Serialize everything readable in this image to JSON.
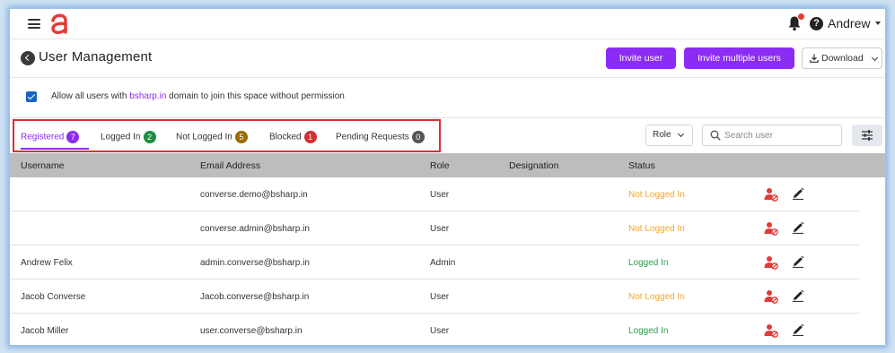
{
  "header": {
    "user_name": "Andrew",
    "notification_dot_color": "#e53935"
  },
  "page": {
    "title": "User Management",
    "invite_label": "Invite user",
    "invite_multiple_label": "Invite multiple users",
    "download_label": "Download"
  },
  "permission": {
    "checked": true,
    "text_before": "Allow all users with ",
    "domain": "bsharp.in",
    "text_after": " domain to join this space without permission"
  },
  "tabs": [
    {
      "label": "Registered",
      "count": "7",
      "color": "#8b2cf5"
    },
    {
      "label": "Logged In",
      "count": "2",
      "color": "#1e8e3e"
    },
    {
      "label": "Not Logged In",
      "count": "5",
      "color": "#9a6b00"
    },
    {
      "label": "Blocked",
      "count": "1",
      "color": "#d32f2f"
    },
    {
      "label": "Pending Requests",
      "count": "0",
      "color": "#555555"
    }
  ],
  "filters": {
    "role_label": "Role",
    "search_placeholder": "Search user"
  },
  "table": {
    "columns": [
      "Username",
      "Email Address",
      "Role",
      "Designation",
      "Status"
    ],
    "rows": [
      {
        "username": "",
        "email": "converse.demo@bsharp.in",
        "role": "User",
        "designation": "",
        "status": "Not Logged In"
      },
      {
        "username": "",
        "email": "converse.admin@bsharp.in",
        "role": "User",
        "designation": "",
        "status": "Not Logged In"
      },
      {
        "username": "Andrew Felix",
        "email": "admin.converse@bsharp.in",
        "role": "Admin",
        "designation": "",
        "status": "Logged In"
      },
      {
        "username": "Jacob Converse",
        "email": "Jacob.converse@bsharp.in",
        "role": "User",
        "designation": "",
        "status": "Not Logged In"
      },
      {
        "username": "Jacob Miller",
        "email": "user.converse@bsharp.in",
        "role": "User",
        "designation": "",
        "status": "Logged In"
      }
    ]
  },
  "colors": {
    "accent": "#8b2cf5",
    "status_not_logged_in": "#f5a623",
    "status_logged_in": "#2e9e4a",
    "action_red": "#e53935"
  }
}
